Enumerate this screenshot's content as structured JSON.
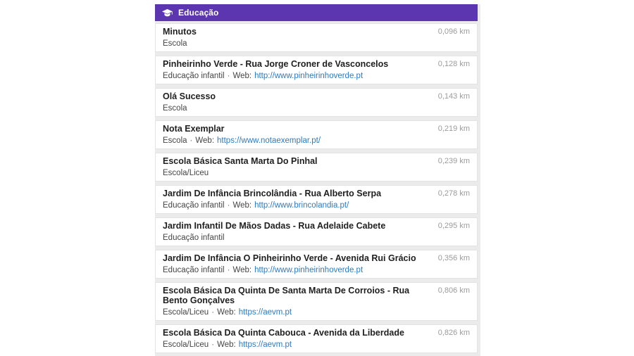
{
  "theme": {
    "header_bg": "#5c35b1",
    "panel_bg": "#ebebeb",
    "link_color": "#2d7bc1",
    "distance_color": "#9b9b9b"
  },
  "header": {
    "title": "Educação",
    "icon": "graduation-cap-icon"
  },
  "labels": {
    "separator": "·",
    "web_prefix": "Web:"
  },
  "list": {
    "items": [
      {
        "title": "Minutos",
        "category": "Escola",
        "web": null,
        "distance": "0,096 km"
      },
      {
        "title": "Pinheirinho Verde - Rua Jorge Croner de Vasconcelos",
        "category": "Educação infantil",
        "web": "http://www.pinheirinhoverde.pt",
        "distance": "0,128 km"
      },
      {
        "title": "Olá Sucesso",
        "category": "Escola",
        "web": null,
        "distance": "0,143 km"
      },
      {
        "title": "Nota Exemplar",
        "category": "Escola",
        "web": "https://www.notaexemplar.pt/",
        "distance": "0,219 km"
      },
      {
        "title": "Escola Básica Santa Marta Do Pinhal",
        "category": "Escola/Liceu",
        "web": null,
        "distance": "0,239 km"
      },
      {
        "title": "Jardim De Infância Brincolândia - Rua Alberto Serpa",
        "category": "Educação infantil",
        "web": "http://www.brincolandia.pt/",
        "distance": "0,278 km"
      },
      {
        "title": "Jardim Infantil De Mãos Dadas - Rua Adelaide Cabete",
        "category": "Educação infantil",
        "web": null,
        "distance": "0,295 km"
      },
      {
        "title": "Jardim De Infância O Pinheirinho Verde - Avenida Rui Grácio",
        "category": "Educação infantil",
        "web": "http://www.pinheirinhoverde.pt",
        "distance": "0,356 km"
      },
      {
        "title": "Escola Básica Da Quinta De Santa Marta De Corroios - Rua Bento Gonçalves",
        "category": "Escola/Liceu",
        "web": "https://aevm.pt",
        "distance": "0,806 km"
      },
      {
        "title": "Escola Básica Da Quinta Cabouca - Avenida da Liberdade",
        "category": "Escola/Liceu",
        "web": "https://aevm.pt",
        "distance": "0,826 km"
      }
    ]
  }
}
